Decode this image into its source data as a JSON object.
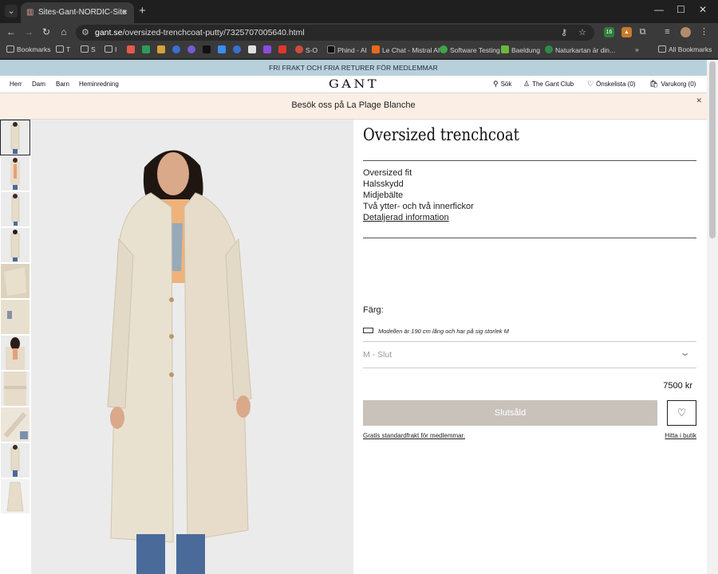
{
  "browser": {
    "tab_title": "Sites-Gant-NORDIC-Site",
    "url_domain": "gant.se",
    "url_path": "/oversized-trenchcoat-putty/7325707005640.html",
    "ext_badge_1": "16",
    "bookmarks": [
      {
        "label": "Bookmarks",
        "color": "#9a9a9a"
      },
      {
        "label": "T",
        "color": "#9a9a9a"
      },
      {
        "label": "S",
        "color": "#9a9a9a"
      },
      {
        "label": "I",
        "color": "#9a9a9a"
      },
      {
        "label": "S-O",
        "color": "#d24a3a"
      },
      {
        "label": "Phind - AI",
        "color": "#111111"
      },
      {
        "label": "Le Chat - Mistral AI",
        "color": "#e86a1a"
      },
      {
        "label": "Software Testing",
        "color": "#3fa548"
      },
      {
        "label": "Baeldung",
        "color": "#6cb63a"
      },
      {
        "label": "Naturkartan är din...",
        "color": "#2f8a4a"
      },
      {
        "label": "All Bookmarks",
        "color": "#9a9a9a"
      }
    ]
  },
  "promo": {
    "text": "FRI FRAKT OCH FRIA RETURER FÖR MEDLEMMAR"
  },
  "nav": {
    "links": [
      "Herr",
      "Dam",
      "Barn",
      "Heminredning"
    ],
    "logo": "GANT",
    "search": "Sök",
    "club": "The Gant Club",
    "wishlist": "Önskelista (0)",
    "cart": "Varukorg (0)"
  },
  "banner": {
    "text": "Besök oss på La Plage Blanche"
  },
  "product": {
    "title": "Oversized trenchcoat",
    "features": [
      "Oversized fit",
      "Halsskydd",
      "Midjebälte",
      "Två ytter- och två innerfickor"
    ],
    "details_link": "Detaljerad information",
    "color_label": "Färg:",
    "model_info": "Modellen är 190 cm lång och har på sig storlek M",
    "size_value": "M - Slut",
    "price": "7500 kr",
    "sold_out_label": "Slutsåld",
    "shipping_link": "Gratis standardfrakt för medlemmar.",
    "store_link": "Hitta i butik"
  },
  "colors": {
    "promo_bg": "#b7d0dc",
    "banner_bg": "#fbeee4",
    "sold_btn": "#c8c2bb",
    "coat": "#e9e1d0"
  }
}
